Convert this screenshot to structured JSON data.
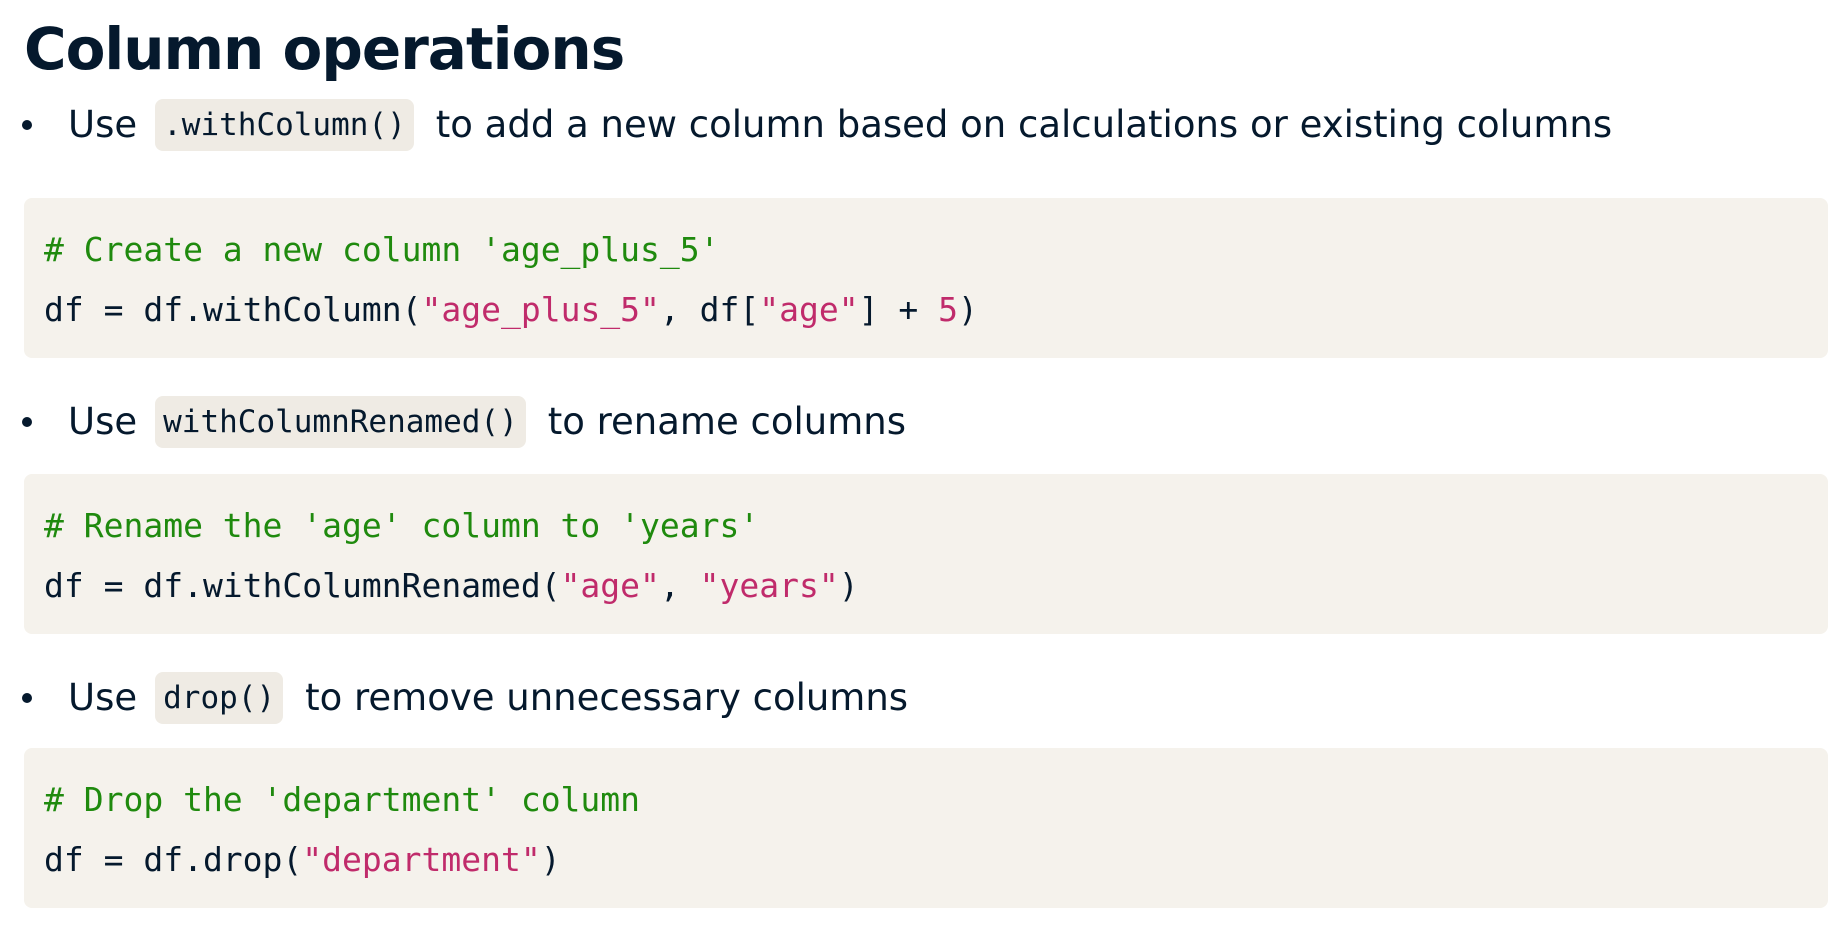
{
  "title": "Column operations",
  "items": [
    {
      "prefix": "Use",
      "code": ".withColumn()",
      "suffix": "to add a new column based on calculations or existing columns",
      "block": {
        "comment": "# Create a new column 'age_plus_5'",
        "line": [
          {
            "type": "plain",
            "text": "df = df.withColumn("
          },
          {
            "type": "string",
            "text": "\"age_plus_5\""
          },
          {
            "type": "plain",
            "text": ", df["
          },
          {
            "type": "string",
            "text": "\"age\""
          },
          {
            "type": "plain",
            "text": "] + "
          },
          {
            "type": "number",
            "text": "5"
          },
          {
            "type": "plain",
            "text": ")"
          }
        ]
      }
    },
    {
      "prefix": "Use",
      "code": "withColumnRenamed()",
      "suffix": "to rename columns",
      "block": {
        "comment": "# Rename the 'age' column to 'years'",
        "line": [
          {
            "type": "plain",
            "text": "df = df.withColumnRenamed("
          },
          {
            "type": "string",
            "text": "\"age\""
          },
          {
            "type": "plain",
            "text": ", "
          },
          {
            "type": "string",
            "text": "\"years\""
          },
          {
            "type": "plain",
            "text": ")"
          }
        ]
      }
    },
    {
      "prefix": "Use",
      "code": "drop()",
      "suffix": "to remove unnecessary columns",
      "block": {
        "comment": "# Drop the 'department' column",
        "line": [
          {
            "type": "plain",
            "text": "df = df.drop("
          },
          {
            "type": "string",
            "text": "\"department\""
          },
          {
            "type": "plain",
            "text": ")"
          }
        ]
      }
    }
  ]
}
